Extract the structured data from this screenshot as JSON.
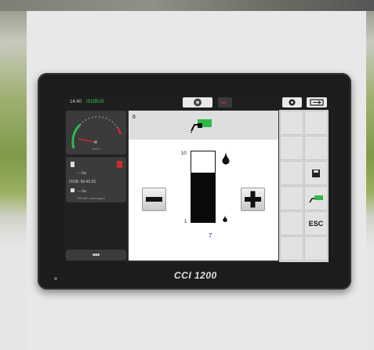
{
  "status_bar": {
    "time": "14:40",
    "status": "ISOBUS"
  },
  "left_panel": {
    "gauge_unit": "km/h",
    "tile2": {
      "line1": "--- ha",
      "line2": "ISOB: 50:45:25",
      "line3": "--- ha",
      "line4": "KRONE Ladewagen"
    },
    "menu_label": "■■■"
  },
  "main": {
    "header_number": "6",
    "scale_max": "10",
    "scale_min": "1",
    "value": "7",
    "fill_fraction": 0.7
  },
  "softkeys": {
    "esc_label": "ESC"
  },
  "device": {
    "brand": "CCI 1200"
  },
  "colors": {
    "accent_green": "#2fb84a",
    "value_blue": "#1a2e9a"
  }
}
